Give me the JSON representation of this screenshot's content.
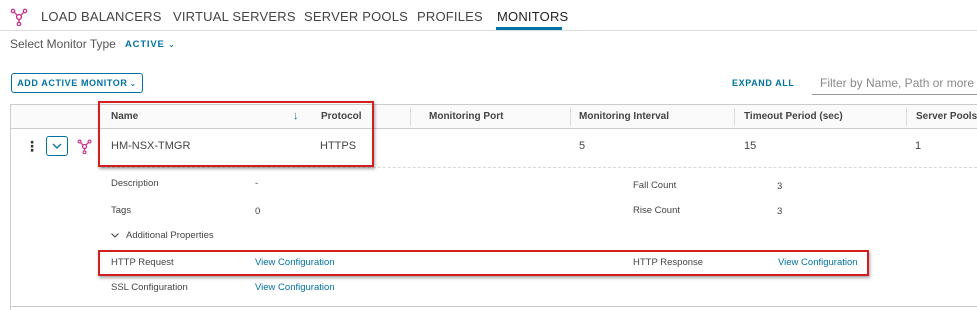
{
  "nav": {
    "icon": "load-balancer-icon",
    "tabs": [
      {
        "label": "LOAD BALANCERS",
        "active": false
      },
      {
        "label": "VIRTUAL SERVERS",
        "active": false
      },
      {
        "label": "SERVER POOLS",
        "active": false
      },
      {
        "label": "PROFILES",
        "active": false
      },
      {
        "label": "MONITORS",
        "active": true
      }
    ]
  },
  "monitor_type": {
    "label": "Select Monitor Type",
    "value": "ACTIVE"
  },
  "toolbar": {
    "add_label": "ADD ACTIVE MONITOR",
    "expand_all_label": "EXPAND ALL",
    "filter_placeholder": "Filter by Name, Path or more"
  },
  "table": {
    "columns": [
      "Name",
      "Protocol",
      "Monitoring Port",
      "Monitoring Interval",
      "Timeout Period (sec)",
      "Server Pools"
    ],
    "rows": [
      {
        "name": "HM-NSX-TMGR",
        "protocol": "HTTPS",
        "monitoring_port": "",
        "monitoring_interval": "5",
        "timeout_period": "15",
        "server_pools": "1",
        "details": {
          "description_label": "Description",
          "description_value": "-",
          "tags_label": "Tags",
          "tags_value": "0",
          "fall_count_label": "Fall Count",
          "fall_count_value": "3",
          "rise_count_label": "Rise Count",
          "rise_count_value": "3",
          "additional_properties_label": "Additional Properties",
          "http_request_label": "HTTP Request",
          "http_request_link": "View Configuration",
          "http_response_label": "HTTP Response",
          "http_response_link": "View Configuration",
          "ssl_configuration_label": "SSL Configuration",
          "ssl_configuration_link": "View Configuration"
        }
      }
    ]
  },
  "colors": {
    "accent": "#0072a3",
    "brand_icon": "#c8338a",
    "highlight": "#d11f1f"
  }
}
